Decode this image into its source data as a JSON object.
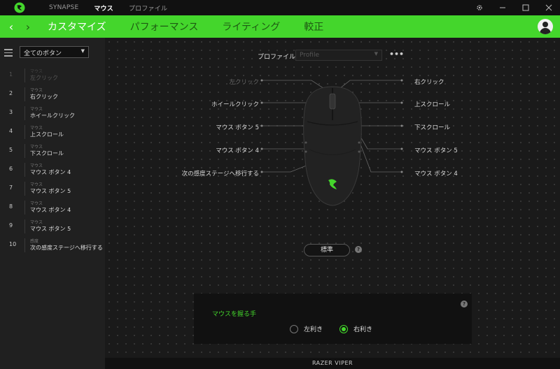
{
  "titlebar": {
    "tabs": [
      "SYNAPSE",
      "マウス",
      "プロファイル"
    ],
    "active_tab": "マウス"
  },
  "navbar": {
    "tabs": [
      "カスタマイズ",
      "パフォーマンス",
      "ライティング",
      "較正"
    ],
    "active_tab": "カスタマイズ"
  },
  "sidebar": {
    "filter": "全てのボタン",
    "bindings": [
      {
        "num": "1",
        "category": "マウス",
        "action": "左クリック",
        "dim": true
      },
      {
        "num": "2",
        "category": "マウス",
        "action": "右クリック"
      },
      {
        "num": "3",
        "category": "マウス",
        "action": "ホイールクリック"
      },
      {
        "num": "4",
        "category": "マウス",
        "action": "上スクロール"
      },
      {
        "num": "5",
        "category": "マウス",
        "action": "下スクロール"
      },
      {
        "num": "6",
        "category": "マウス",
        "action": "マウス ボタン 4"
      },
      {
        "num": "7",
        "category": "マウス",
        "action": "マウス ボタン 5"
      },
      {
        "num": "8",
        "category": "マウス",
        "action": "マウス ボタン 4"
      },
      {
        "num": "9",
        "category": "マウス",
        "action": "マウス ボタン 5"
      },
      {
        "num": "10",
        "category": "感度",
        "action": "次の感度ステージへ移行する"
      }
    ]
  },
  "profile": {
    "label": "プロファイル",
    "selected": "Profile"
  },
  "mouse_labels": {
    "left": [
      "左クリック",
      "ホイールクリック",
      "マウス ボタン 5",
      "マウス ボタン 4",
      "次の感度ステージへ移行する"
    ],
    "right": [
      "右クリック",
      "上スクロール",
      "下スクロール",
      "マウス ボタン 5",
      "マウス ボタン 4"
    ]
  },
  "standard_button": "標準",
  "hand": {
    "title": "マウスを握る手",
    "left": "左利き",
    "right": "右利き",
    "selected": "右利き"
  },
  "device_name": "RAZER VIPER",
  "colors": {
    "accent": "#44d62c",
    "background": "#1a1a1a"
  }
}
